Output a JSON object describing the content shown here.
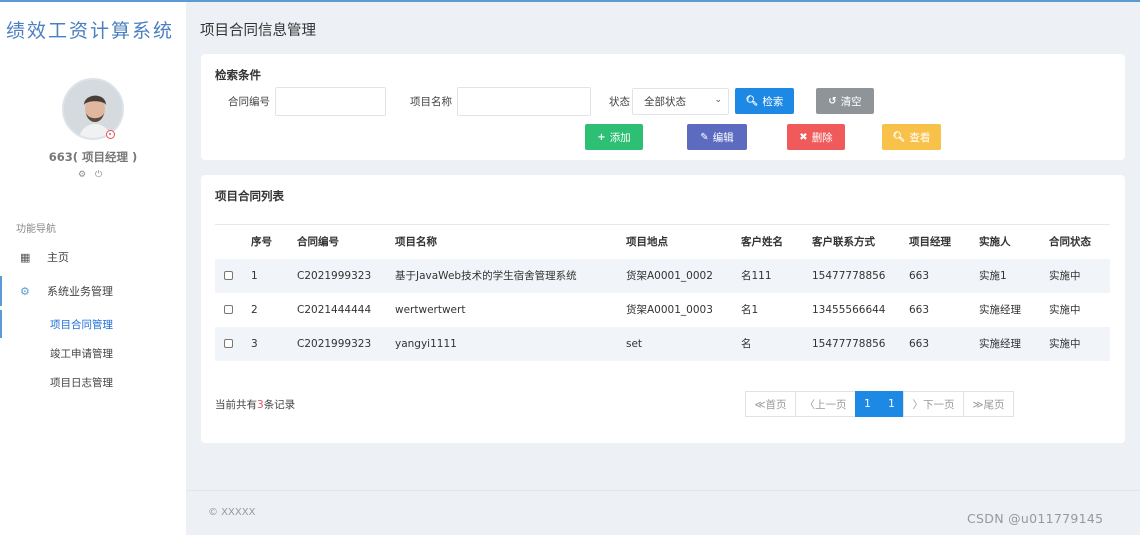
{
  "brand": "绩效工资计算系统",
  "user": {
    "name": "663( 项目经理 )",
    "settings_icon": "gear-icon",
    "logout_icon": "power-icon"
  },
  "nav": {
    "section_label": "功能导航",
    "home": "主页",
    "business": "系统业务管理",
    "sub_items": [
      "项目合同管理",
      "竣工申请管理",
      "项目日志管理"
    ]
  },
  "page": {
    "title": "项目合同信息管理"
  },
  "search": {
    "title": "检索条件",
    "contract_no_label": "合同编号",
    "contract_no_value": "",
    "project_name_label": "项目名称",
    "project_name_value": "",
    "status_label": "状态",
    "status_selected": "全部状态",
    "search_button": "检索",
    "clear_button": "清空"
  },
  "actions": {
    "add": "添加",
    "edit": "编辑",
    "delete": "删除",
    "view": "查看"
  },
  "colors": {
    "primary": "#1e88e5",
    "success": "#2dbf73",
    "edit": "#5c6bc0",
    "danger": "#f05a5a",
    "warning": "#f8c24a",
    "clear": "#8f9498"
  },
  "list": {
    "title": "项目合同列表",
    "columns": [
      "序号",
      "合同编号",
      "项目名称",
      "项目地点",
      "客户姓名",
      "客户联系方式",
      "项目经理",
      "实施人",
      "合同状态"
    ],
    "rows": [
      [
        "1",
        "C2021999323",
        "基于JavaWeb技术的学生宿舍管理系统",
        "货架A0001_0002",
        "名111",
        "15477778856",
        "663",
        "实施1",
        "实施中"
      ],
      [
        "2",
        "C2021444444",
        "wertwertwert",
        "货架A0001_0003",
        "名1",
        "13455566644",
        "663",
        "实施经理",
        "实施中"
      ],
      [
        "3",
        "C2021999323",
        "yangyi1111",
        "set",
        "名",
        "15477778856",
        "663",
        "实施经理",
        "实施中"
      ]
    ]
  },
  "pagination": {
    "summary_prefix": "当前共有",
    "summary_count": "3",
    "summary_suffix": "条记录",
    "first": "≪首页",
    "prev": "〈上一页",
    "pages": [
      "1",
      "1"
    ],
    "next": "〉下一页",
    "last": "≫尾页"
  },
  "footer": {
    "copyright": "© XXXXX",
    "watermark": "CSDN @u011779145"
  }
}
